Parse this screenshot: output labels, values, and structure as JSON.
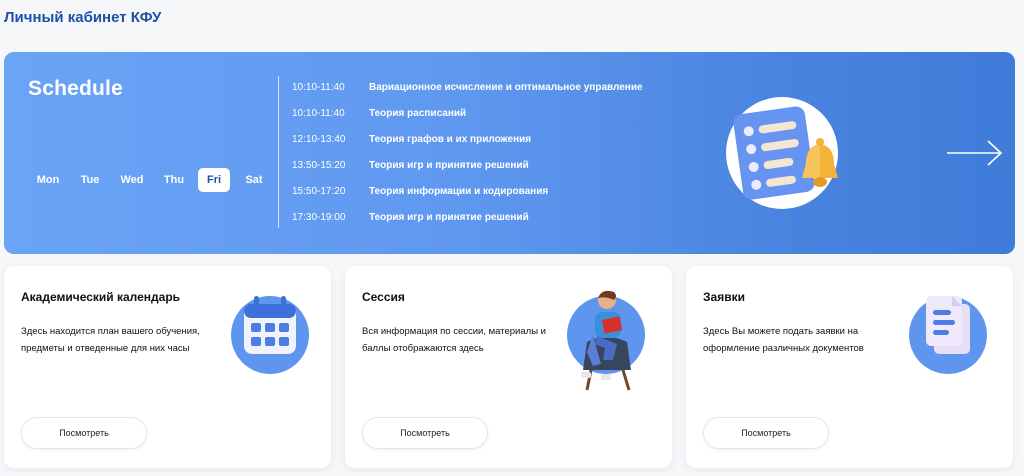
{
  "page_title": "Личный кабинет КФУ",
  "schedule": {
    "title": "Schedule",
    "days": [
      "Mon",
      "Tue",
      "Wed",
      "Thu",
      "Fri",
      "Sat"
    ],
    "active_day": "Fri",
    "lessons": [
      {
        "time": "10:10-11:40",
        "subject": "Вариационное исчисление и оптимальное управление"
      },
      {
        "time": "10:10-11:40",
        "subject": "Теория расписаний"
      },
      {
        "time": "12:10-13:40",
        "subject": "Теория графов и их приложения"
      },
      {
        "time": "13:50-15:20",
        "subject": "Теория игр и принятие решений"
      },
      {
        "time": "15:50-17:20",
        "subject": "Теория информации и кодирования"
      },
      {
        "time": "17:30-19:00",
        "subject": "Теория игр и принятие решений"
      }
    ],
    "next_icon": "arrow-right-icon",
    "illustration_icon": "schedule-list-bell-icon"
  },
  "cards": [
    {
      "title": "Академический календарь",
      "description": "Здесь находится план вашего обучения, предметы и отведенные для них часы",
      "button": "Посмотреть",
      "icon": "calendar-icon"
    },
    {
      "title": "Сессия",
      "description": "Вся информация по сессии, материалы и баллы отображаются здесь",
      "button": "Посмотреть",
      "icon": "student-reading-icon"
    },
    {
      "title": "Заявки",
      "description": "Здесь Вы можете подать заявки на оформление различных документов",
      "button": "Посмотреть",
      "icon": "documents-icon"
    }
  ],
  "colors": {
    "brand": "#1f4fa8",
    "banner_start": "#6aa4f6",
    "banner_end": "#3f7bd8",
    "card_accent": "#5e96ef"
  }
}
